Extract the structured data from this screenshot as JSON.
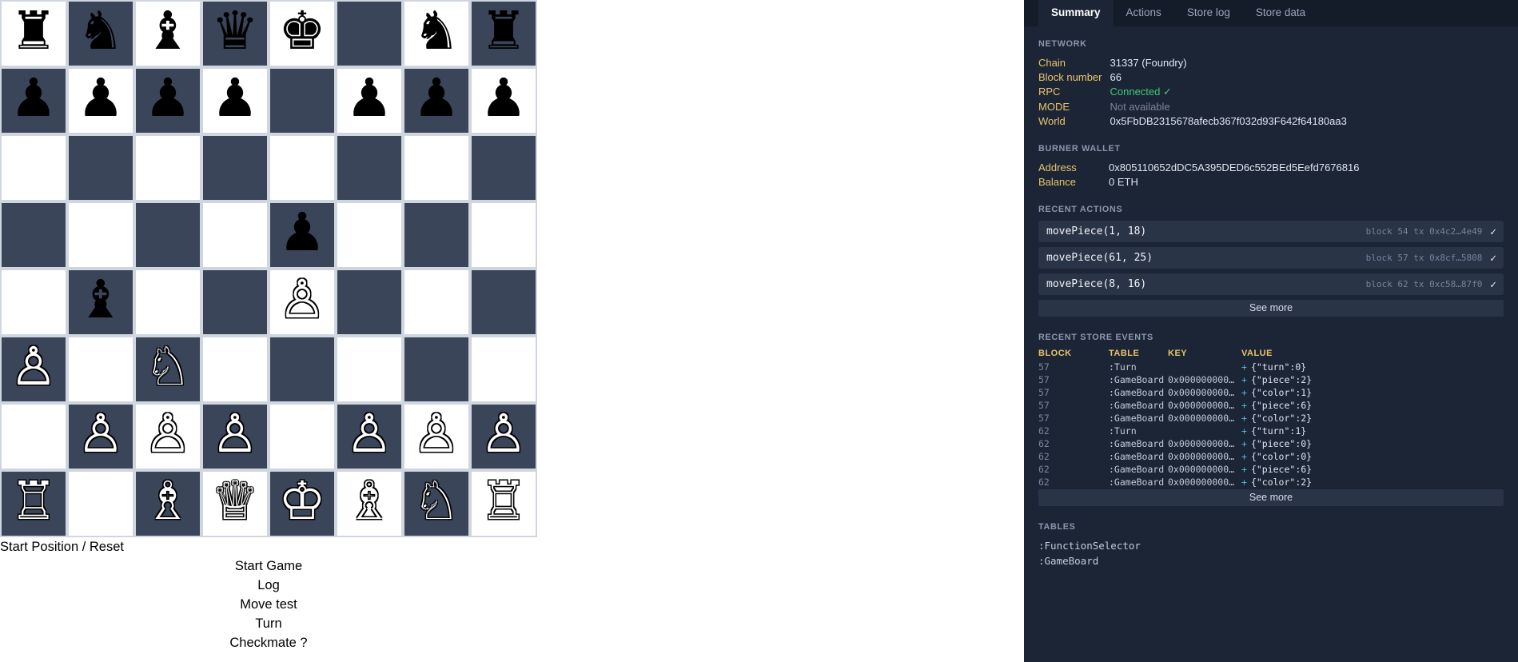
{
  "board": {
    "light_color": "#ffffff",
    "dark_color": "#3b455a",
    "squares": [
      [
        {
          "p": "♜",
          "c": "black"
        },
        {
          "p": "♞",
          "c": "black"
        },
        {
          "p": "♝",
          "c": "black"
        },
        {
          "p": "♛",
          "c": "black"
        },
        {
          "p": "♚",
          "c": "black"
        },
        {
          "p": "",
          "c": ""
        },
        {
          "p": "♞",
          "c": "black"
        },
        {
          "p": "♜",
          "c": "black"
        }
      ],
      [
        {
          "p": "♟",
          "c": "black"
        },
        {
          "p": "♟",
          "c": "black"
        },
        {
          "p": "♟",
          "c": "black"
        },
        {
          "p": "♟",
          "c": "black"
        },
        {
          "p": "",
          "c": ""
        },
        {
          "p": "♟",
          "c": "black"
        },
        {
          "p": "♟",
          "c": "black"
        },
        {
          "p": "♟",
          "c": "black"
        }
      ],
      [
        {
          "p": "",
          "c": ""
        },
        {
          "p": "",
          "c": ""
        },
        {
          "p": "",
          "c": ""
        },
        {
          "p": "",
          "c": ""
        },
        {
          "p": "",
          "c": ""
        },
        {
          "p": "",
          "c": ""
        },
        {
          "p": "",
          "c": ""
        },
        {
          "p": "",
          "c": ""
        }
      ],
      [
        {
          "p": "",
          "c": ""
        },
        {
          "p": "",
          "c": ""
        },
        {
          "p": "",
          "c": ""
        },
        {
          "p": "",
          "c": ""
        },
        {
          "p": "♟",
          "c": "black"
        },
        {
          "p": "",
          "c": ""
        },
        {
          "p": "",
          "c": ""
        },
        {
          "p": "",
          "c": ""
        }
      ],
      [
        {
          "p": "",
          "c": ""
        },
        {
          "p": "♝",
          "c": "black"
        },
        {
          "p": "",
          "c": ""
        },
        {
          "p": "",
          "c": ""
        },
        {
          "p": "♙",
          "c": "white"
        },
        {
          "p": "",
          "c": ""
        },
        {
          "p": "",
          "c": ""
        },
        {
          "p": "",
          "c": ""
        }
      ],
      [
        {
          "p": "♙",
          "c": "white"
        },
        {
          "p": "",
          "c": ""
        },
        {
          "p": "♘",
          "c": "white"
        },
        {
          "p": "",
          "c": ""
        },
        {
          "p": "",
          "c": ""
        },
        {
          "p": "",
          "c": ""
        },
        {
          "p": "",
          "c": ""
        },
        {
          "p": "",
          "c": ""
        }
      ],
      [
        {
          "p": "",
          "c": ""
        },
        {
          "p": "♙",
          "c": "white"
        },
        {
          "p": "♙",
          "c": "white"
        },
        {
          "p": "♙",
          "c": "white"
        },
        {
          "p": "",
          "c": ""
        },
        {
          "p": "♙",
          "c": "white"
        },
        {
          "p": "♙",
          "c": "white"
        },
        {
          "p": "♙",
          "c": "white"
        }
      ],
      [
        {
          "p": "♖",
          "c": "white"
        },
        {
          "p": "",
          "c": ""
        },
        {
          "p": "♗",
          "c": "white"
        },
        {
          "p": "♕",
          "c": "white"
        },
        {
          "p": "♔",
          "c": "white"
        },
        {
          "p": "♗",
          "c": "white"
        },
        {
          "p": "♘",
          "c": "white"
        },
        {
          "p": "♖",
          "c": "white"
        }
      ]
    ]
  },
  "controls": [
    {
      "label": "Start Position / Reset"
    },
    {
      "label": "Start Game"
    },
    {
      "label": "Log"
    },
    {
      "label": "Move test"
    },
    {
      "label": "Turn"
    },
    {
      "label": "Checkmate ?"
    }
  ],
  "devpanel": {
    "tabs": [
      {
        "label": "Summary",
        "active": true
      },
      {
        "label": "Actions",
        "active": false
      },
      {
        "label": "Store log",
        "active": false
      },
      {
        "label": "Store data",
        "active": false
      }
    ],
    "network": {
      "title": "NETWORK",
      "rows": [
        {
          "key": "Chain",
          "value": "31337 (Foundry)",
          "style": "normal"
        },
        {
          "key": "Block number",
          "value": "66",
          "style": "normal"
        },
        {
          "key": "RPC",
          "value": "Connected ✓",
          "style": "green"
        },
        {
          "key": "MODE",
          "value": "Not available",
          "style": "muted"
        },
        {
          "key": "World",
          "value": "0x5FbDB2315678afecb367f032d93F642f64180aa3",
          "style": "normal"
        }
      ]
    },
    "burner_wallet": {
      "title": "BURNER WALLET",
      "rows": [
        {
          "key": "Address",
          "value": "0x805110652dDC5A395DED6c552BEd5Eefd7676816",
          "style": "normal"
        },
        {
          "key": "Balance",
          "value": "0 ETH",
          "style": "normal"
        }
      ]
    },
    "recent_actions": {
      "title": "RECENT ACTIONS",
      "items": [
        {
          "name": "movePiece(1, 18)",
          "meta": "block 54 tx 0x4c2…4e49",
          "status": "✓"
        },
        {
          "name": "movePiece(61, 25)",
          "meta": "block 57 tx 0x8cf…5808",
          "status": "✓"
        },
        {
          "name": "movePiece(8, 16)",
          "meta": "block 62 tx 0xc58…87f0",
          "status": "✓"
        }
      ],
      "see_more": "See more"
    },
    "recent_store_events": {
      "title": "RECENT STORE EVENTS",
      "columns": [
        "BLOCK",
        "TABLE",
        "KEY",
        "VALUE"
      ],
      "rows": [
        {
          "block": "57",
          "table": ":Turn",
          "key": "",
          "value": "{\"turn\":0}"
        },
        {
          "block": "57",
          "table": ":GameBoard",
          "key": "0x000000000…",
          "value": "{\"piece\":2}"
        },
        {
          "block": "57",
          "table": ":GameBoard",
          "key": "0x000000000…",
          "value": "{\"color\":1}"
        },
        {
          "block": "57",
          "table": ":GameBoard",
          "key": "0x000000000…",
          "value": "{\"piece\":6}"
        },
        {
          "block": "57",
          "table": ":GameBoard",
          "key": "0x000000000…",
          "value": "{\"color\":2}"
        },
        {
          "block": "62",
          "table": ":Turn",
          "key": "",
          "value": "{\"turn\":1}"
        },
        {
          "block": "62",
          "table": ":GameBoard",
          "key": "0x000000000…",
          "value": "{\"piece\":0}"
        },
        {
          "block": "62",
          "table": ":GameBoard",
          "key": "0x000000000…",
          "value": "{\"color\":0}"
        },
        {
          "block": "62",
          "table": ":GameBoard",
          "key": "0x000000000…",
          "value": "{\"piece\":6}"
        },
        {
          "block": "62",
          "table": ":GameBoard",
          "key": "0x000000000…",
          "value": "{\"color\":2}"
        }
      ],
      "see_more": "See more"
    },
    "tables": {
      "title": "TABLES",
      "items": [
        {
          "label": ":FunctionSelector"
        },
        {
          "label": ":GameBoard"
        }
      ]
    }
  }
}
